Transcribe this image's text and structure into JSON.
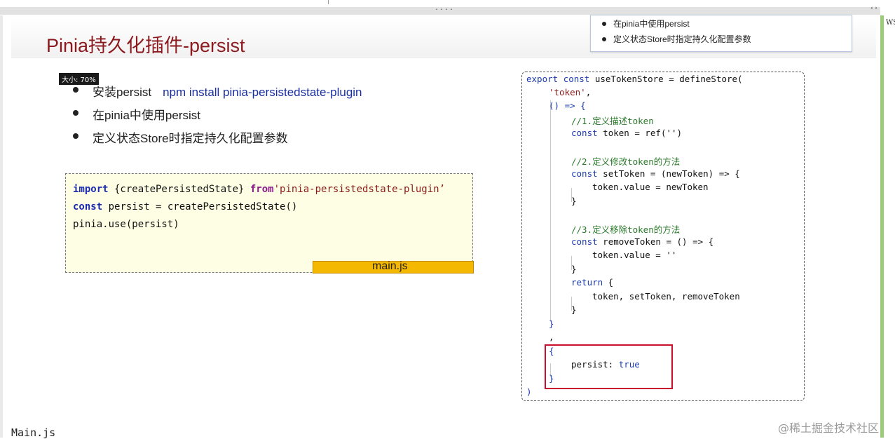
{
  "drag_handle": "....",
  "collapse_arrows": "‹ ›",
  "side_label": "WS",
  "slide": {
    "title": "Pinia持久化插件-persist",
    "mini_panel_items": [
      "在pinia中使用persist",
      "定义状态Store时指定持久化配置参数"
    ],
    "size_tag": "大小: 70%",
    "bullets": [
      {
        "text": "安装persist",
        "command": "npm install pinia-persistedstate-plugin"
      },
      {
        "text": "在pinia中使用persist"
      },
      {
        "text": "定义状态Store时指定持久化配置参数"
      }
    ],
    "main_code": {
      "line1_kw": "import",
      "line1_mid": " {createPersistedState} ",
      "line1_kw2": "from",
      "line1_str": "'pinia-persistedstate-plugin’",
      "line2_kw": "const",
      "line2_rest": " persist = createPersistedState()",
      "line3": "pinia.use(persist)"
    },
    "file_tab": "main.js",
    "store_code": {
      "l1_kw1": "export",
      "l1_kw2": "const",
      "l1_rest": " useTokenStore = defineStore(",
      "l2": "'token'",
      "l2_tail": ",",
      "l3": "() => {",
      "l4": "//1.定义描述token",
      "l5_kw": "const",
      "l5_rest": " token = ref('')",
      "l6": "//2.定义修改token的方法",
      "l7_kw": "const",
      "l7_rest": " setToken = (newToken) => {",
      "l8": "token.value = newToken",
      "l9": "}",
      "l10": "//3.定义移除token的方法",
      "l11_kw": "const",
      "l11_rest": " removeToken = () => {",
      "l12": "token.value = ''",
      "l13": "}",
      "l14_kw": "return",
      "l14_rest": " {",
      "l15": "token, setToken, removeToken",
      "l16": "}",
      "l17": "}",
      "l18": ",",
      "l19": "{",
      "l20_key": "persist: ",
      "l20_val": "true",
      "l21": "}",
      "l22": ")"
    }
  },
  "bottom_text": "Main.js",
  "watermark": "@稀土掘金技术社区"
}
